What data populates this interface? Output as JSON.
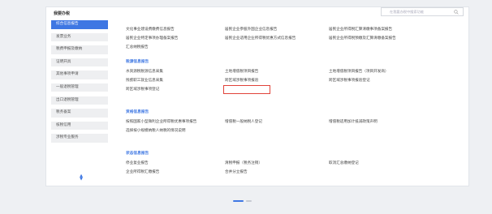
{
  "sidebar": {
    "title": "我要办税",
    "items": [
      {
        "label": "综合信息报告",
        "active": true
      },
      {
        "label": "发票业务"
      },
      {
        "label": "税费申报及缴纳"
      },
      {
        "label": "证明开具"
      },
      {
        "label": "其他事项申请"
      },
      {
        "label": "一般退税管理"
      },
      {
        "label": "出口退税管理"
      },
      {
        "label": "税务备案"
      },
      {
        "label": "核税信用"
      },
      {
        "label": "涉税专业服务"
      }
    ]
  },
  "search": {
    "placeholder": "在我要办税中搜索功能"
  },
  "content": {
    "row1": [
      "文化事业建设费缴费信息报告",
      "居民企业参股外国企业信息报告",
      "居民企业所得税汇算清缴事项备案报告"
    ],
    "row2": [
      "居民企业特定事项办理备案报告",
      "居民企业适用企业所得税优惠方式信息报告",
      "居民企业所得税预缴及汇算清缴备案报告"
    ],
    "row3": [
      "汇总纳税报告"
    ],
    "sections": {
      "management": "税源信息报告",
      "invoice": "资格信息报告",
      "status": "状态信息报告"
    },
    "management_links": [
      "水资源税税源信息采集",
      "土地增值税项目报告",
      "土地增值税项目报告（项目开发商）",
      "残疾职工就业信息采集",
      "跨区域涉税事项报验",
      "跨区域涉税事项报验登记",
      "跨区域涉税事项登记"
    ],
    "invoice_links": [
      "按照国家小型微利企业所得税优惠事项报告",
      "增值税一般纳税人登记",
      "增值税适用加计抵减政策声明",
      "选择按小规模纳税人纳税的情况说明"
    ],
    "status_links": [
      "停业复业报告",
      "清税申报（税务注销）",
      "取消汇总缴纳登记",
      "企业所得税汇缴报告",
      "合并分立报告"
    ]
  }
}
